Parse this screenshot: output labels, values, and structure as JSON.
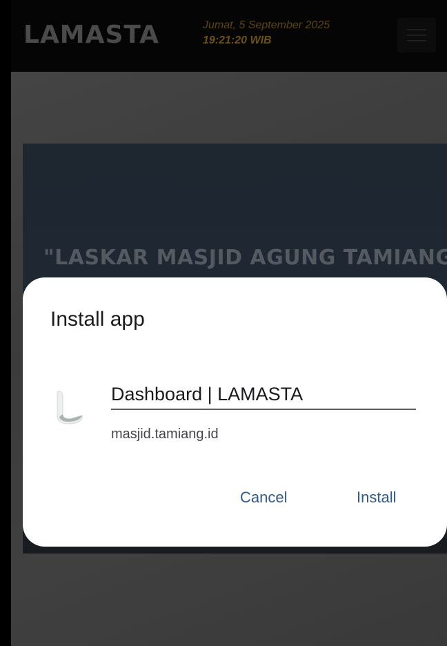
{
  "header": {
    "logo": "LAMASTA",
    "date": "Jumat, 5 September 2025",
    "time": "19:21:20 WIB"
  },
  "banner": {
    "title": "\"LASKAR MASJID AGUNG TAMIANG\""
  },
  "dialog": {
    "title": "Install app",
    "app_name": "Dashboard | LAMASTA",
    "app_url": "masjid.tamiang.id",
    "cancel_label": "Cancel",
    "install_label": "Install",
    "icon": "app-logo-icon"
  },
  "colors": {
    "header_bg": "#050505",
    "scrim_bg": "#3d3d3d",
    "dialog_bg": "#ffffff",
    "button_text": "#2f5a8e"
  }
}
